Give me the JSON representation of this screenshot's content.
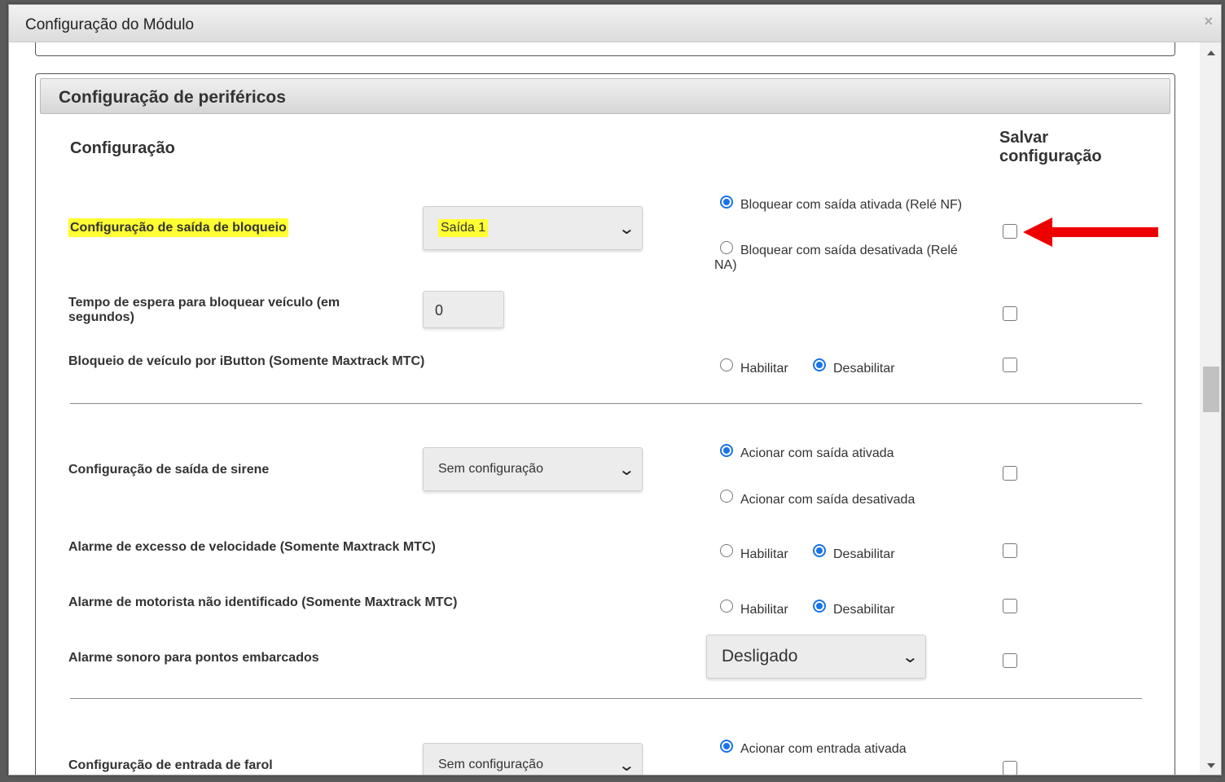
{
  "modal": {
    "title": "Configuração do Módulo",
    "close": "×"
  },
  "panel": {
    "title": "Configuração de periféricos",
    "col_config": "Configuração",
    "col_save": "Salvar configuração"
  },
  "rows": {
    "bloqueio": {
      "label": "Configuração de saída de bloqueio",
      "select_value": "Saída 1",
      "radio1": "Bloquear com saída ativada (Relé NF)",
      "radio2": "Bloquear com saída desativada (Relé NA)",
      "selected": 1
    },
    "tempo": {
      "label": "Tempo de espera para bloquear veículo (em segundos)",
      "value": "0"
    },
    "ibutton": {
      "label": "Bloqueio de veículo por iButton (Somente Maxtrack MTC)",
      "opt1": "Habilitar",
      "opt2": "Desabilitar",
      "selected": 2
    },
    "sirene": {
      "label": "Configuração de saída de sirene",
      "select_value": "Sem configuração",
      "radio1": "Acionar com saída ativada",
      "radio2": "Acionar com saída desativada",
      "selected": 1
    },
    "velocidade": {
      "label": "Alarme de excesso de velocidade (Somente Maxtrack MTC)",
      "opt1": "Habilitar",
      "opt2": "Desabilitar",
      "selected": 2
    },
    "motorista": {
      "label": "Alarme de motorista não identificado (Somente Maxtrack MTC)",
      "opt1": "Habilitar",
      "opt2": "Desabilitar",
      "selected": 2
    },
    "sonoro": {
      "label": "Alarme sonoro para pontos embarcados",
      "select_value": "Desligado"
    },
    "farol": {
      "label": "Configuração de entrada de farol",
      "select_value": "Sem configuração",
      "radio1": "Acionar com entrada ativada",
      "selected": 1
    }
  },
  "colors": {
    "accent": "#1a73e8",
    "highlight": "#ffff33",
    "arrow": "#ee0000"
  }
}
